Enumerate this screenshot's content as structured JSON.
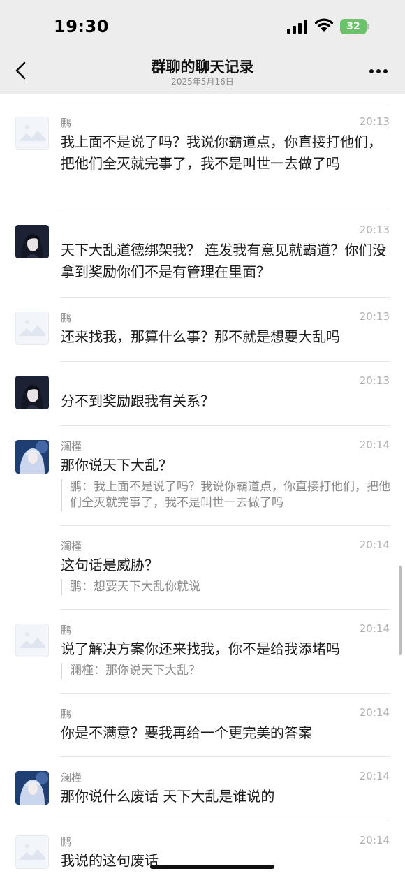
{
  "status_bar": {
    "time": "19:30",
    "battery": "32"
  },
  "header": {
    "title": "群聊的聊天记录",
    "subtitle": "2025年5月16日"
  },
  "messages": [
    {
      "sender": "鹏",
      "time": "20:13",
      "text": "我上面不是说了吗？我说你霸道点，你直接打他们，把他们全灭就完事了，我不是叫世一去做了吗",
      "avatar": "placeholder"
    },
    {
      "sender": "",
      "time": "20:13",
      "text": "天下大乱道德绑架我？ 连发我有意见就霸道？你们没拿到奖励你们不是有管理在里面？",
      "avatar": "anime-dark"
    },
    {
      "sender": "鹏",
      "time": "20:13",
      "text": "还来找我，那算什么事？那不就是想要大乱吗",
      "avatar": "placeholder"
    },
    {
      "sender": "",
      "time": "20:13",
      "text": "分不到奖励跟我有关系？",
      "avatar": "anime-dark"
    },
    {
      "sender": "澜槿",
      "time": "20:14",
      "text": "那你说天下大乱？",
      "quote": "鹏：我上面不是说了吗？我说你霸道点，你直接打他们，把他们全灭就完事了，我不是叫世一去做了吗",
      "avatar": "anime-blue"
    },
    {
      "sender": "澜槿",
      "time": "20:14",
      "text": "这句话是威胁？",
      "quote": "鹏：想要天下大乱你就说",
      "avatar": "none"
    },
    {
      "sender": "鹏",
      "time": "20:14",
      "text": "说了解决方案你还来找我，你不是给我添堵吗",
      "quote": "澜槿：那你说天下大乱？",
      "avatar": "placeholder"
    },
    {
      "sender": "鹏",
      "time": "20:14",
      "text": "你是不满意？要我再给一个更完美的答案",
      "avatar": "none"
    },
    {
      "sender": "澜槿",
      "time": "20:14",
      "text": "那你说什么废话 天下大乱是谁说的",
      "avatar": "anime-blue"
    },
    {
      "sender": "鹏",
      "time": "20:14",
      "text": "我说的这句废话",
      "avatar": "placeholder"
    }
  ],
  "colors": {
    "background": "#ffffff",
    "header_bg": "#ededed",
    "battery": "#6cc26a",
    "text": "#1a1a1a",
    "meta": "#8b8b8b"
  }
}
